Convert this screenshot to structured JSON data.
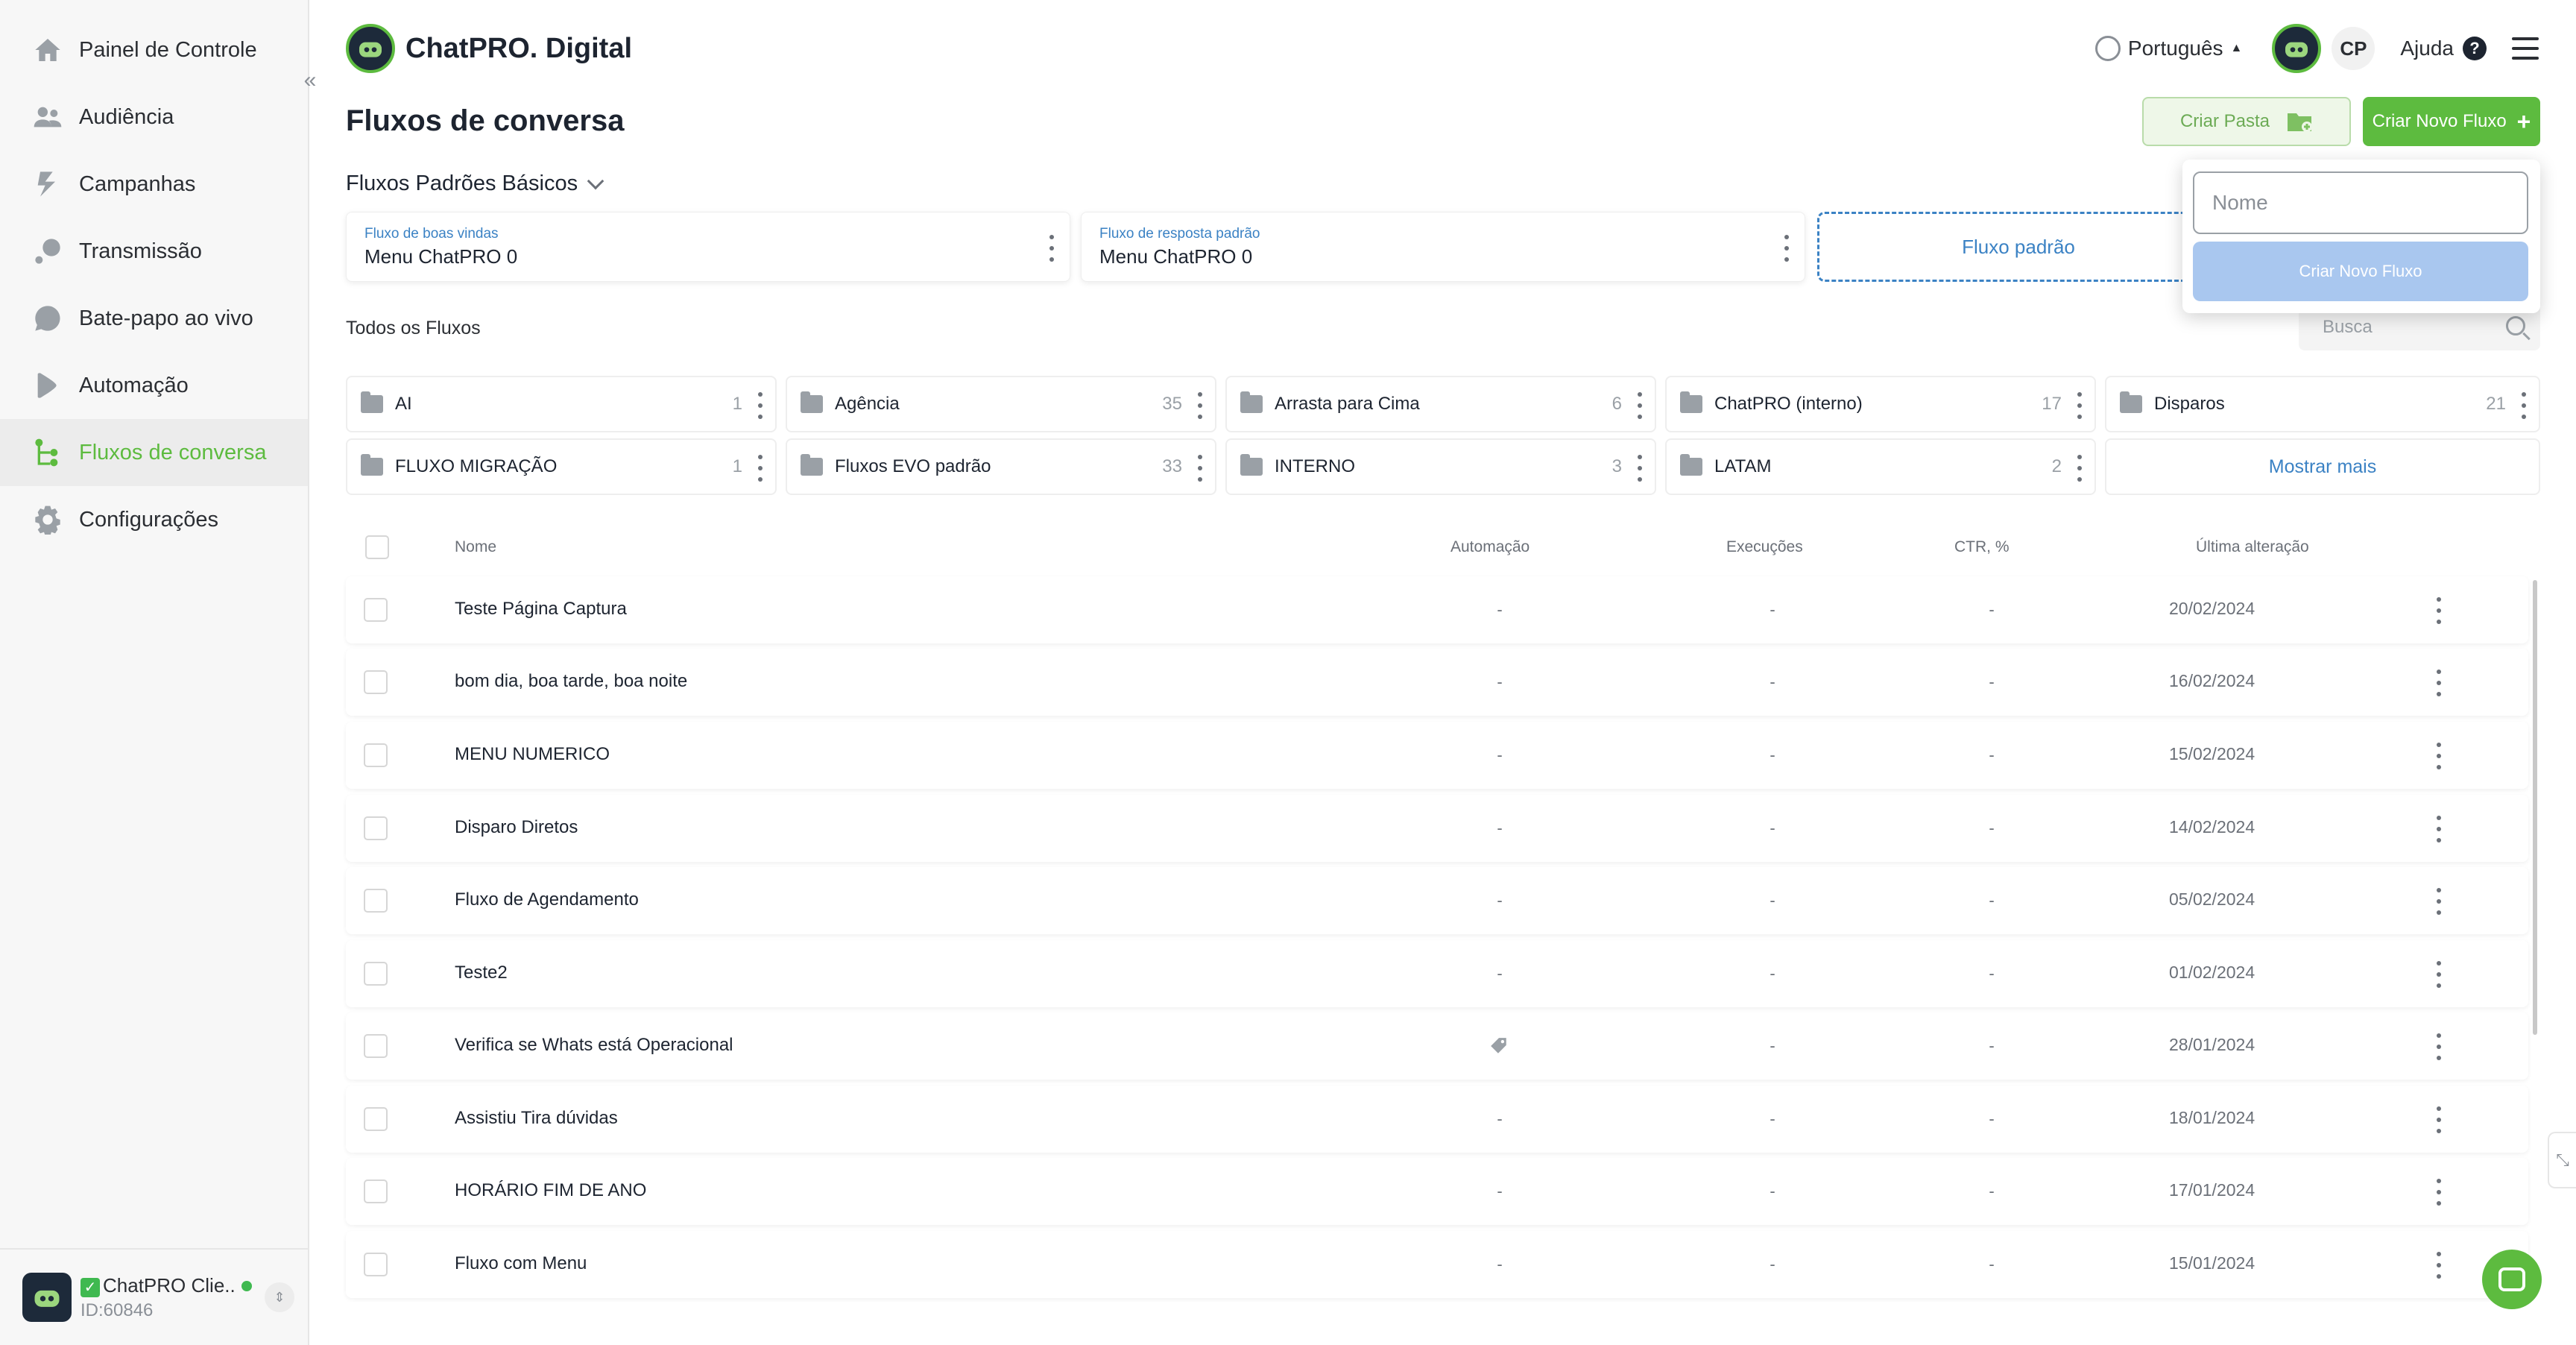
{
  "sidebar": {
    "items": [
      {
        "label": "Painel de Controle",
        "icon": "home-icon"
      },
      {
        "label": "Audiência",
        "icon": "users-icon"
      },
      {
        "label": "Campanhas",
        "icon": "campaign-icon"
      },
      {
        "label": "Transmissão",
        "icon": "broadcast-icon"
      },
      {
        "label": "Bate-papo ao vivo",
        "icon": "chat-icon"
      },
      {
        "label": "Automação",
        "icon": "automation-icon"
      },
      {
        "label": "Fluxos de conversa",
        "icon": "flow-icon",
        "active": true
      },
      {
        "label": "Configurações",
        "icon": "gear-icon"
      }
    ],
    "account": {
      "name": "ChatPRO Clie...",
      "id": "ID:60846"
    }
  },
  "header": {
    "brand": "ChatPRO. Digital",
    "language": "Português",
    "initials": "CP",
    "help": "Ajuda"
  },
  "page": {
    "title": "Fluxos de conversa",
    "create_folder": "Criar Pasta",
    "create_flow": "Criar Novo Fluxo"
  },
  "basic": {
    "title": "Fluxos Padrões Básicos",
    "cards": [
      {
        "label": "Fluxo de boas vindas",
        "value": "Menu ChatPRO 0"
      },
      {
        "label": "Fluxo de resposta padrão",
        "value": "Menu ChatPRO 0"
      }
    ],
    "dashed": "Fluxo padrão"
  },
  "all": {
    "title": "Todos os Fluxos",
    "search_placeholder": "Busca"
  },
  "folders": [
    {
      "name": "AI",
      "count": "1"
    },
    {
      "name": "Agência",
      "count": "35"
    },
    {
      "name": "Arrasta para Cima",
      "count": "6"
    },
    {
      "name": "ChatPRO (interno)",
      "count": "17"
    },
    {
      "name": "Disparos",
      "count": "21"
    },
    {
      "name": "FLUXO MIGRAÇÃO",
      "count": "1"
    },
    {
      "name": "Fluxos EVO padrão",
      "count": "33"
    },
    {
      "name": "INTERNO",
      "count": "3"
    },
    {
      "name": "LATAM",
      "count": "2"
    }
  ],
  "show_more": "Mostrar mais",
  "table": {
    "headers": {
      "name": "Nome",
      "automation": "Automação",
      "executions": "Execuções",
      "ctr": "CTR, %",
      "last": "Última alteração"
    },
    "rows": [
      {
        "name": "Teste Página Captura",
        "automation": "-",
        "executions": "-",
        "ctr": "-",
        "date": "20/02/2024"
      },
      {
        "name": "bom dia, boa tarde, boa noite",
        "automation": "-",
        "executions": "-",
        "ctr": "-",
        "date": "16/02/2024"
      },
      {
        "name": "MENU NUMERICO",
        "automation": "-",
        "executions": "-",
        "ctr": "-",
        "date": "15/02/2024"
      },
      {
        "name": "Disparo Diretos",
        "automation": "-",
        "executions": "-",
        "ctr": "-",
        "date": "14/02/2024"
      },
      {
        "name": "Fluxo de Agendamento",
        "automation": "-",
        "executions": "-",
        "ctr": "-",
        "date": "05/02/2024"
      },
      {
        "name": "Teste2",
        "automation": "-",
        "executions": "-",
        "ctr": "-",
        "date": "01/02/2024"
      },
      {
        "name": "Verifica se Whats está Operacional",
        "automation": "tag-icon",
        "executions": "-",
        "ctr": "-",
        "date": "28/01/2024"
      },
      {
        "name": "Assistiu Tira dúvidas",
        "automation": "-",
        "executions": "-",
        "ctr": "-",
        "date": "18/01/2024"
      },
      {
        "name": "HORÁRIO FIM DE ANO",
        "automation": "-",
        "executions": "-",
        "ctr": "-",
        "date": "17/01/2024"
      },
      {
        "name": "Fluxo com Menu",
        "automation": "-",
        "executions": "-",
        "ctr": "-",
        "date": "15/01/2024"
      }
    ]
  },
  "popup": {
    "placeholder": "Nome",
    "button": "Criar Novo Fluxo"
  },
  "colors": {
    "accent": "#5dbb3f",
    "link": "#3b82c4",
    "sidebar_bg": "#f7f7f7"
  }
}
